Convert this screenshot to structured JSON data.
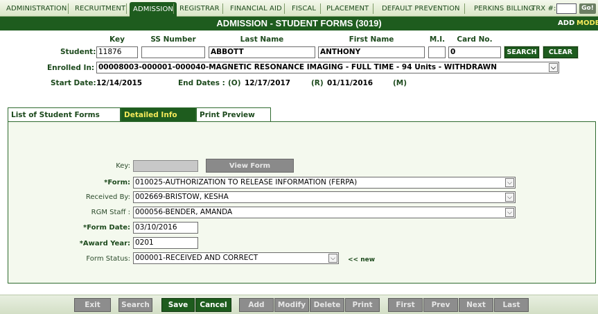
{
  "nav": {
    "items": [
      {
        "label": "ADMINISTRATION",
        "active": false
      },
      {
        "label": "RECRUITMENT",
        "active": false
      },
      {
        "label": "ADMISSION",
        "active": true
      },
      {
        "label": "REGISTRAR",
        "active": false
      },
      {
        "label": "FINANCIAL AID",
        "active": false
      },
      {
        "label": "FISCAL",
        "active": false
      },
      {
        "label": "PLACEMENT",
        "active": false
      },
      {
        "label": "DEFAULT PREVENTION",
        "active": false
      },
      {
        "label": "PERKINS BILLING",
        "active": false
      }
    ],
    "trx_label": "TRX #:",
    "trx_value": "",
    "go_label": "Go!"
  },
  "header": {
    "title": "ADMISSION - STUDENT FORMS (3019)",
    "mode_value": "ADD",
    "mode_label": "MODE"
  },
  "student": {
    "label": "Student:",
    "columns": {
      "key": "Key",
      "ssn": "SS Number",
      "last": "Last Name",
      "first": "First Name",
      "mi": "M.I.",
      "card": "Card No."
    },
    "key": "11876",
    "ssn": "",
    "last_name": "ABBOTT",
    "first_name": "ANTHONY",
    "mi": "",
    "card_no": "0",
    "search_label": "SEARCH",
    "clear_label": "CLEAR",
    "enrolled_label": "Enrolled In:",
    "enrolled_value": "00008003-000001-000040-MAGNETIC RESONANCE IMAGING - FULL TIME - 94 Units - WITHDRAWN",
    "start_label": "Start Date:",
    "start_value": "12/14/2015",
    "end_label": "End Dates :",
    "end_o_label": "(O)",
    "end_o_value": "12/17/2017",
    "end_r_label": "(R)",
    "end_r_value": "01/11/2016",
    "end_m_label": "(M)"
  },
  "tabs": [
    {
      "label": "List of Student Forms",
      "active": false
    },
    {
      "label": "Detailed Info",
      "active": true
    },
    {
      "label": "Print Preview",
      "active": false
    }
  ],
  "form": {
    "key_label": "Key:",
    "key_value": "",
    "view_form_label": "View Form",
    "form_label": "*Form:",
    "form_value": "010025-AUTHORIZATION TO RELEASE INFORMATION (FERPA)",
    "received_label": "Received By:",
    "received_value": "002669-BRISTOW, KESHA",
    "staff_label": "RGM Staff :",
    "staff_value": "000056-BENDER, AMANDA",
    "form_date_label": "*Form Date:",
    "form_date_value": "03/10/2016",
    "award_year_label": "*Award Year:",
    "award_year_value": "0201",
    "status_label": "Form Status:",
    "status_value": "000001-RECEIVED AND CORRECT",
    "new_link": "<< new"
  },
  "toolbar": {
    "exit": "Exit",
    "search": "Search",
    "save": "Save",
    "cancel": "Cancel",
    "add": "Add",
    "modify": "Modify",
    "delete": "Delete",
    "print": "Print",
    "first": "First",
    "prev": "Prev",
    "next": "Next",
    "last": "Last"
  },
  "colors": {
    "primary_green": "#1e5c1e",
    "active_tab_text": "#f4e95a",
    "disabled_button": "#8d8d8d"
  }
}
